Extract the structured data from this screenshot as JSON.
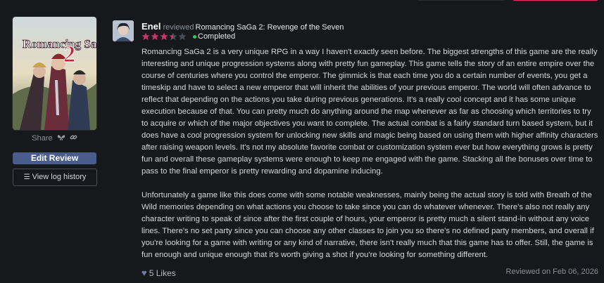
{
  "review": {
    "username": "Enel",
    "action": "reviewed",
    "game_title": "Romancing SaGa 2: Revenge of the Seven",
    "rating": 3.5,
    "rating_max": 5,
    "status": "Completed",
    "paragraphs": [
      "Romancing SaGa 2 is a very unique RPG in a way I haven't exactly seen before. The biggest strengths of this game are the really interesting and unique progression systems along with pretty fun gameplay. This game tells the story of an entire empire over the course of centuries where you control the emperor. The gimmick is that each time you do a certain number of events, you get a timeskip and have to select a new emperor that will inherit the abilities of your previous emperor. The world will often advance to reflect that depending on the actions you take during previous generations. It's a really cool concept and it has some unique execution because of that. You can pretty much do anything around the map whenever as far as choosing which territories to try to acquire or which of the major objectives you want to complete. The actual combat is a fairly standard turn based system, but it does have a cool progression system for unlocking new skills and magic being based on using them with higher affinity characters after raising weapon levels. It's not my absolute favorite combat or customization system ever but how everything grows is pretty fun and overall these gameplay systems were enough to keep me engaged with the game. Stacking all the bonuses over time to pass to the final emperor is pretty rewarding and dopamine inducing.",
      "Unfortunately a game like this does come with some notable weaknesses, mainly being the actual story is told with Breath of the Wild memories depending on what actions you choose to take since you can do whatever whenever. There's also not really any character writing to speak of since after the first couple of hours, your emperor is pretty much a silent stand-in without any voice lines. There's no set party since you can choose any other classes to join you so there's no defined party members, and overall if you're looking for a game with writing or any kind of narrative, there isn't really much that this game has to offer. Still, the game is fun enough and unique enough that it's worth giving a shot if you're looking for something different."
    ],
    "likes_label": "5 Likes",
    "reviewed_on": "Reviewed on Feb 06, 2026"
  },
  "sidebar": {
    "cover_logo_text": "Romancing SaGa",
    "cover_logo_number": "2",
    "share_label": "Share",
    "edit_review_label": "Edit Review",
    "view_log_label": "View log history"
  },
  "colors": {
    "background": "#16181c",
    "accent_pink": "#e2336b",
    "edit_button": "#4a5c8a",
    "star_filled": "#c8366c",
    "star_empty": "#4a4e55",
    "completed_dot": "#34c759"
  },
  "icons": {
    "share": "butterfly-icon",
    "link": "link-icon",
    "log": "list-icon",
    "likes": "heart-icon"
  }
}
